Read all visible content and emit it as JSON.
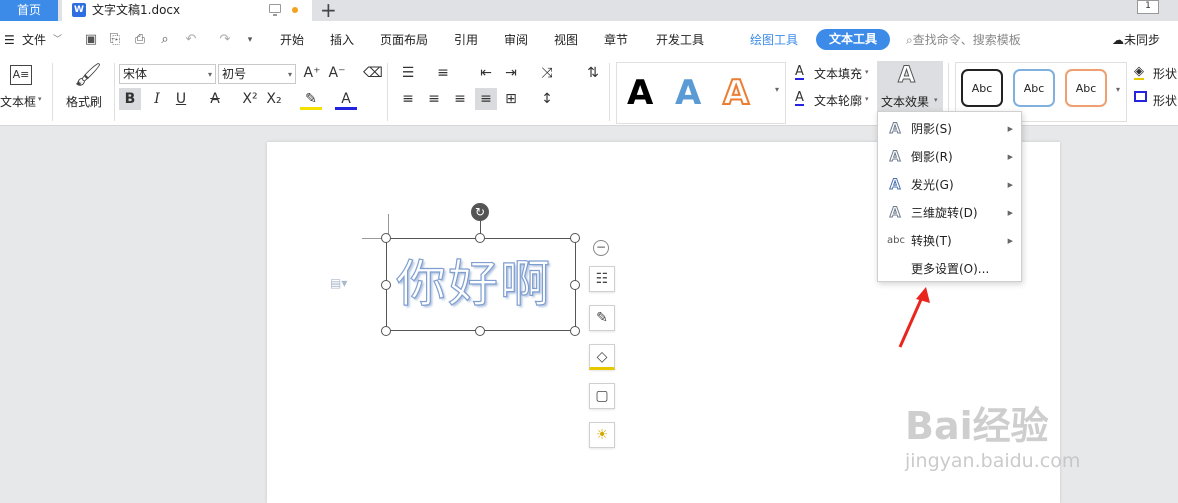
{
  "tabs": {
    "home": "首页",
    "doc_title": "文字文稿1.docx",
    "doc_icon": "W",
    "new_tab": "+",
    "right_badge": "1"
  },
  "menu": {
    "file": "文件",
    "items": [
      "开始",
      "插入",
      "页面布局",
      "引用",
      "审阅",
      "视图",
      "章节",
      "开发工具"
    ],
    "drawing_tools": "绘图工具",
    "text_tools": "文本工具",
    "search_placeholder": "查找命令、搜索模板",
    "sync": "未同步"
  },
  "ribbon": {
    "textbox_label": "文本框",
    "format_painter": "格式刷",
    "font_name": "宋体",
    "font_size": "初号",
    "text_fill": "文本填充",
    "text_outline": "文本轮廓",
    "text_effect": "文本效果",
    "shape_fill": "形状",
    "shape_outline": "形状",
    "wordart_samples": [
      "A",
      "A",
      "A"
    ],
    "abc_samples": [
      "Abc",
      "Abc",
      "Abc"
    ]
  },
  "document": {
    "wordart_text": "你好啊"
  },
  "dropdown": {
    "items": [
      {
        "icon": "A",
        "label": "阴影(S)",
        "submenu": true
      },
      {
        "icon": "A",
        "label": "倒影(R)",
        "submenu": true
      },
      {
        "icon": "A",
        "label": "发光(G)",
        "submenu": true
      },
      {
        "icon": "A",
        "label": "三维旋转(D)",
        "submenu": true
      },
      {
        "icon": "abc",
        "label": "转换(T)",
        "submenu": true
      }
    ],
    "more_settings": "更多设置(O)..."
  },
  "colors": {
    "accent": "#3c8be8",
    "wordart_black": "#000000",
    "wordart_blue": "#5b9bd5",
    "wordart_orange": "#ed7d31",
    "arrow_red": "#e8261d"
  },
  "watermark": {
    "line1": "Bai经验",
    "line2": "jingyan.baidu.com"
  }
}
